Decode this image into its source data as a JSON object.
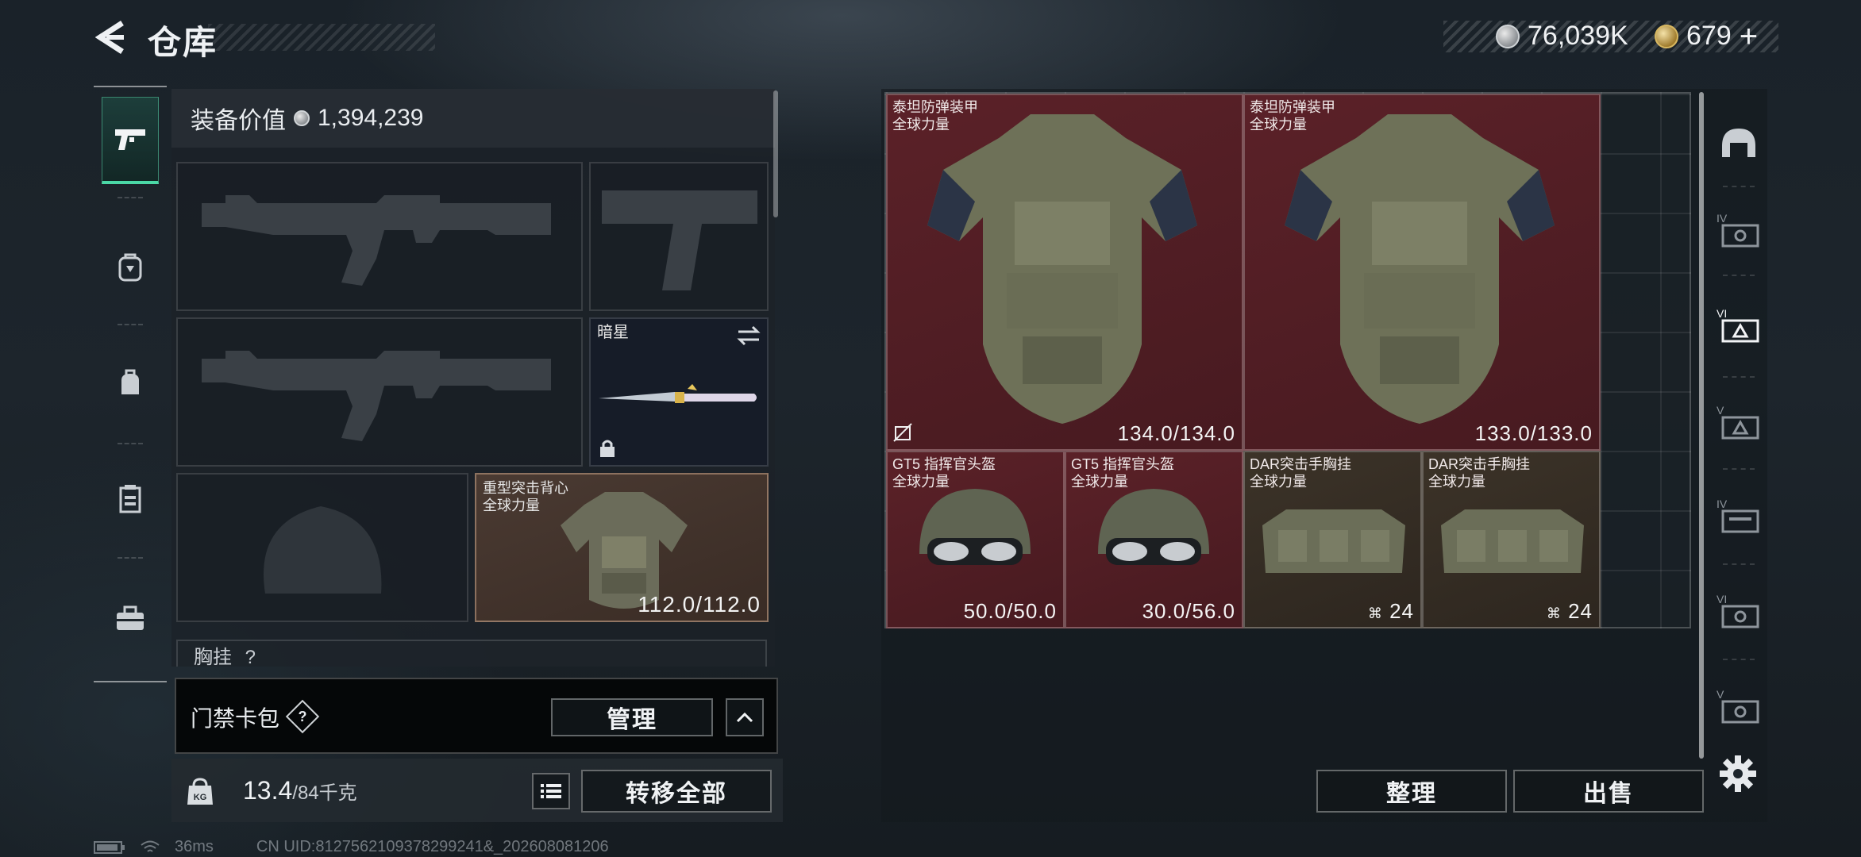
{
  "header": {
    "title": "仓库",
    "currencies": [
      {
        "name": "silver-coin-icon",
        "value": "76,039K"
      },
      {
        "name": "gold-coin-icon",
        "value": "679"
      }
    ],
    "add_symbol": "+"
  },
  "left_tabs": [
    "pistol-icon",
    "backpack-tab-icon",
    "bag-icon",
    "vest-icon",
    "toolbox-icon"
  ],
  "equipment": {
    "value_label": "装备价值",
    "value": "1,394,239",
    "melee_slot": {
      "name": "暗星"
    },
    "armor_slot": {
      "name_line1": "重型突击背心",
      "name_line2": "全球力量",
      "durability": "112.0/112.0"
    },
    "partial_label": "胸挂",
    "partial_symbol": "?"
  },
  "keycard": {
    "label": "门禁卡包",
    "help": "?",
    "manage_button": "管理"
  },
  "weight": {
    "current": "13.4",
    "max": "/84千克",
    "transfer_button": "转移全部"
  },
  "inventory": {
    "items": [
      {
        "name_line1": "泰坦防弹装甲",
        "name_line2": "全球力量",
        "durability": "134.0/134.0",
        "rarity": "red"
      },
      {
        "name_line1": "泰坦防弹装甲",
        "name_line2": "全球力量",
        "durability": "133.0/133.0",
        "rarity": "red"
      },
      {
        "name_line1": "GT5 指挥官头盔",
        "name_line2": "全球力量",
        "durability": "50.0/50.0",
        "rarity": "red"
      },
      {
        "name_line1": "GT5 指挥官头盔",
        "name_line2": "全球力量",
        "durability": "30.0/56.0",
        "rarity": "red"
      },
      {
        "name_line1": "DAR突击手胸挂",
        "name_line2": "全球力量",
        "capacity": "24",
        "rarity": "gold"
      },
      {
        "name_line1": "DAR突击手胸挂",
        "name_line2": "全球力量",
        "capacity": "24",
        "rarity": "gold"
      }
    ],
    "sort_button": "整理",
    "sell_button": "出售"
  },
  "right_filters": [
    "helmet-filter-icon",
    "armor-iv-filter-icon",
    "armor-vi-filter-icon",
    "armor-v-filter-icon",
    "rig-iv-filter-icon",
    "armor-vi-b-filter-icon",
    "armor-v-b-filter-icon"
  ],
  "footer": {
    "ping": "36ms",
    "uid": "CN UID:8127562109378299241&_202608081206"
  },
  "colors": {
    "accent": "#4bd8a6",
    "red_rarity": "#5b2128",
    "gold_rarity": "#3c3328"
  }
}
